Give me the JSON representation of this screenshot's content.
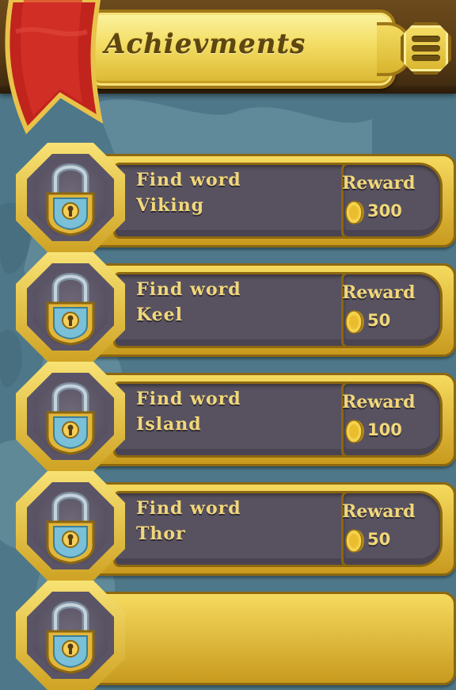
{
  "header": {
    "title": "Achievments",
    "menu_icon": "menu-list-icon",
    "ribbon_color": "#c0241c"
  },
  "achievements": [
    {
      "prefix": "Find word",
      "word": "Viking",
      "reward_label": "Reward",
      "reward": "300",
      "locked": true
    },
    {
      "prefix": "Find word",
      "word": "Keel",
      "reward_label": "Reward",
      "reward": "50",
      "locked": true
    },
    {
      "prefix": "Find word",
      "word": "Island",
      "reward_label": "Reward",
      "reward": "100",
      "locked": true
    },
    {
      "prefix": "Find word",
      "word": "Thor",
      "reward_label": "Reward",
      "reward": "50",
      "locked": true
    }
  ],
  "icons": {
    "lock": "padlock-icon",
    "coin": "gold-coin-icon"
  },
  "colors": {
    "background": "#4e7889",
    "gold": "#e8c440",
    "panel": "#585260",
    "text": "#f1d77a"
  }
}
